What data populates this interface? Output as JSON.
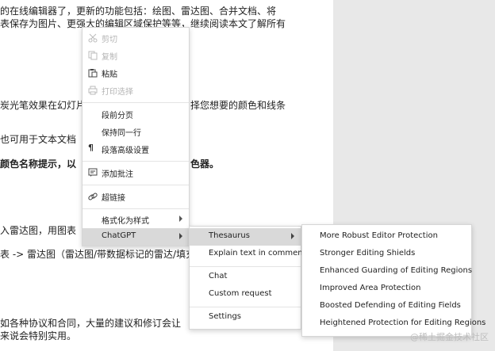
{
  "document": {
    "lines": [
      "的在线编辑器了，更新的功能包括：绘图、雷达图、合并文档、将",
      "表保存为图片、更强大的编辑区域保护等等，继续阅读本文了解所有",
      "炭光笔效果在幻灯片",
      "择您想要的颜色和线条",
      "也可用于文本文档",
      "颜色名称提示，以",
      "色器。",
      "入雷达图，用图表",
      "表 -> 雷达图（雷达图/带数据标记的雷达/填充",
      "如各种协议和合同，大量的建议和修订会让",
      "来说会特别实用。"
    ]
  },
  "context_menu": {
    "items": [
      {
        "label": "剪切",
        "icon": "scissors-icon",
        "disabled": true
      },
      {
        "label": "复制",
        "icon": "copy-icon",
        "disabled": true
      },
      {
        "label": "粘贴",
        "icon": "paste-icon",
        "disabled": false
      },
      {
        "label": "打印选择",
        "icon": "print-icon",
        "disabled": true
      },
      {
        "label": "段前分页",
        "icon": "",
        "disabled": false
      },
      {
        "label": "保持同一行",
        "icon": "",
        "disabled": false
      },
      {
        "label": "段落高级设置",
        "icon": "pilcrow-icon",
        "disabled": false
      },
      {
        "label": "添加批注",
        "icon": "comment-icon",
        "disabled": false
      },
      {
        "label": "超链接",
        "icon": "link-icon",
        "disabled": false
      },
      {
        "label": "格式化为样式",
        "icon": "",
        "disabled": false,
        "submenu": true
      },
      {
        "label": "ChatGPT",
        "icon": "",
        "disabled": false,
        "submenu": true,
        "active": true
      }
    ]
  },
  "chatgpt_menu": {
    "items": [
      {
        "label": "Thesaurus",
        "submenu": true,
        "active": true
      },
      {
        "label": "Explain text in comment"
      },
      {
        "label": "Chat"
      },
      {
        "label": "Custom request"
      },
      {
        "label": "Settings"
      }
    ]
  },
  "thesaurus_menu": {
    "items": [
      "More Robust Editor Protection",
      "Stronger Editing Shields",
      "Enhanced Guarding of Editing Regions",
      "Improved Area Protection",
      "Boosted Defending of Editing Fields",
      "Heightened Protection for Editing Regions"
    ]
  },
  "watermark": "@稀土掘金技术社区",
  "colors": {
    "menu_bg": "#ffffff",
    "active_bg": "#d9d9d9",
    "disabled_text": "#b5b5b5",
    "side_gray": "#e8e8e8"
  }
}
